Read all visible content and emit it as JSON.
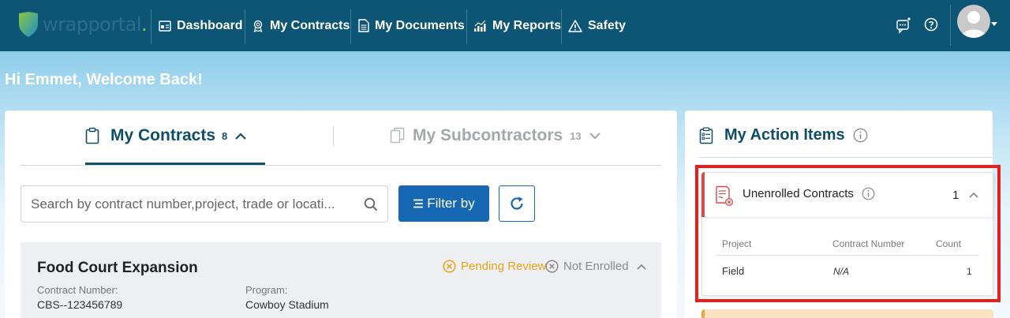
{
  "brand": {
    "name": "wrapportal",
    "dot": "."
  },
  "nav": {
    "items": [
      {
        "label": "Dashboard",
        "icon": "dashboard-icon"
      },
      {
        "label": "My Contracts",
        "icon": "award-icon"
      },
      {
        "label": "My Documents",
        "icon": "document-icon"
      },
      {
        "label": "My Reports",
        "icon": "chart-icon"
      },
      {
        "label": "Safety",
        "icon": "warning-icon"
      }
    ]
  },
  "welcome": "Hi Emmet, Welcome Back!",
  "tabs": {
    "contracts": {
      "label": "My Contracts",
      "count": "8"
    },
    "subcontractors": {
      "label": "My Subcontractors",
      "count": "13"
    }
  },
  "search": {
    "placeholder": "Search by contract number,project, trade or locati..."
  },
  "filter_label": "Filter by",
  "contract": {
    "title": "Food Court Expansion",
    "status_pending": "Pending Review",
    "status_enrollment": "Not Enrolled",
    "number_label": "Contract Number:",
    "number_value": "CBS--123456789",
    "program_label": "Program:",
    "program_value": "Cowboy Stadium"
  },
  "action_items": {
    "title": "My Action Items",
    "card": {
      "title": "Unenrolled Contracts",
      "count": "1",
      "columns": [
        "Project",
        "Contract Number",
        "Count"
      ],
      "rows": [
        {
          "project": "Field",
          "contract_number": "N/A",
          "count": "1"
        }
      ]
    }
  },
  "colors": {
    "nav_bg": "#0d5575",
    "primary": "#1668b2",
    "title": "#0f4e69",
    "pending": "#e8a317",
    "highlight": "#ea1d1d"
  }
}
